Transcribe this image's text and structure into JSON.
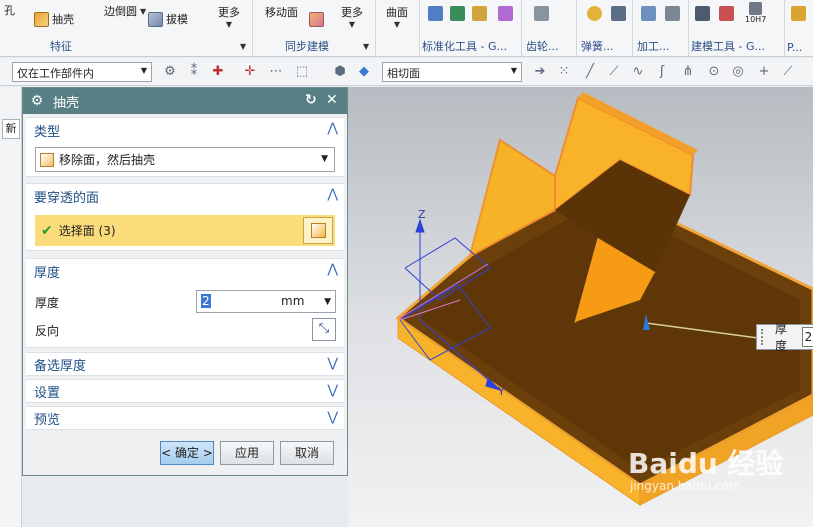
{
  "ribbon": {
    "feature_group": {
      "label": "特征",
      "items": [
        "孔",
        "抽壳",
        "边倒圆",
        "拔模",
        "更多"
      ]
    },
    "sync_group": {
      "label": "同步建模",
      "items": [
        "移动面",
        "更多"
      ]
    },
    "surface_btn": "曲面",
    "std_tools": "标准化工具 - G...",
    "gear": "齿轮...",
    "spring": "弹簧...",
    "machining": "加工...",
    "modeling_tools": "建模工具 - G...",
    "more": "P...",
    "tolerance": "10H7"
  },
  "toolbar": {
    "scope_combo": "仅在工作部件内",
    "face_rule_combo": "相切面"
  },
  "dialog": {
    "title": "抽壳",
    "sections": {
      "type": {
        "header": "类型",
        "value": "移除面，然后抽壳"
      },
      "pierce": {
        "header": "要穿透的面",
        "select_label": "选择面 (3)"
      },
      "thickness": {
        "header": "厚度",
        "thickness_label": "厚度",
        "thickness_value": "2",
        "unit": "mm",
        "reverse_label": "反向"
      },
      "alt_thickness": "备选厚度",
      "settings": "设置",
      "preview": "预览"
    },
    "buttons": {
      "ok": "< 确定 >",
      "apply": "应用",
      "cancel": "取消"
    }
  },
  "viewport": {
    "thickness_tip_label": "厚度",
    "thickness_tip_value": "2",
    "axis_z": "Z",
    "axis_y": "Y",
    "watermark_main": "Baidu 经验",
    "watermark_url": "jingyan.baidu.com"
  },
  "left_strip": {
    "tab_char": "新"
  }
}
